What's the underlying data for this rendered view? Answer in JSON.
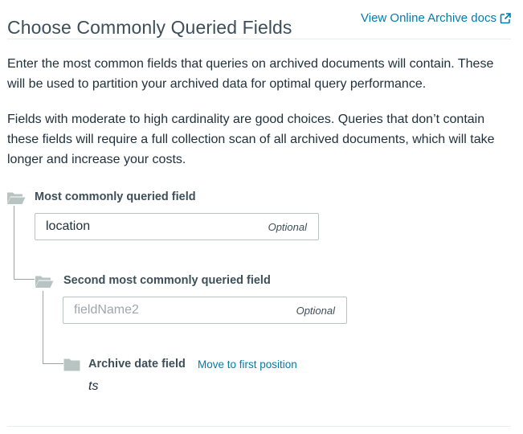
{
  "header": {
    "title": "Choose Commonly Queried Fields",
    "docs_link": "View Online Archive docs",
    "docs_icon": "external-link-icon"
  },
  "intro": {
    "paragraph1": "Enter the most common fields that queries on archived documents will contain. These will be used to partition your archived data for optimal query performance.",
    "paragraph2": "Fields with moderate to high cardinality are good choices. Queries that don’t contain these fields will require a full collection scan of all archived documents, which will take longer and increase your costs."
  },
  "fields": {
    "first": {
      "label": "Most commonly queried field",
      "value": "location",
      "placeholder": "",
      "hint": "Optional",
      "icon": "folder-open-icon"
    },
    "second": {
      "label": "Second most commonly queried field",
      "value": "",
      "placeholder": "fieldName2",
      "hint": "Optional",
      "icon": "folder-open-icon"
    },
    "date": {
      "label": "Archive date field",
      "action": "Move to first position",
      "value": "ts",
      "icon": "folder-closed-icon"
    }
  },
  "colors": {
    "link": "#007cad",
    "folder": "#b8c4c2",
    "tree_line": "#9aa7a7"
  }
}
